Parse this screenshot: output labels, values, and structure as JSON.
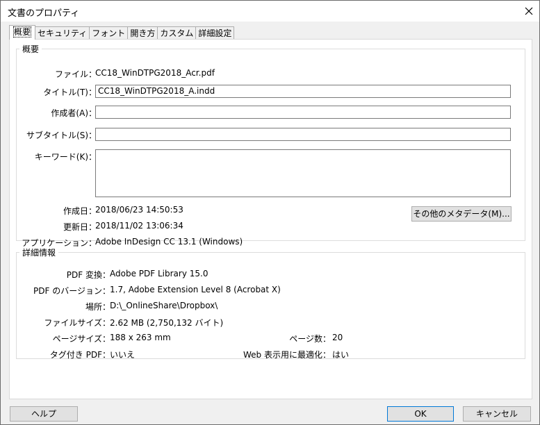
{
  "window": {
    "title": "文書のプロパティ"
  },
  "tabs": [
    {
      "label": "概要"
    },
    {
      "label": "セキュリティ"
    },
    {
      "label": "フォント"
    },
    {
      "label": "開き方"
    },
    {
      "label": "カスタム"
    },
    {
      "label": "詳細設定"
    }
  ],
  "summary": {
    "heading": "概要",
    "file_label": "ファイル：",
    "file_value": "CC18_WinDTPG2018_Acr.pdf",
    "title_label": "タイトル(T)：",
    "title_value": "CC18_WinDTPG2018_A.indd",
    "author_label": "作成者(A)：",
    "author_value": "",
    "subject_label": "サブタイトル(S)：",
    "subject_value": "",
    "keywords_label": "キーワード(K)：",
    "keywords_value": "",
    "created_label": "作成日：",
    "created_value": "2018/06/23 14:50:53",
    "modified_label": "更新日：",
    "modified_value": "2018/11/02 13:06:34",
    "application_label": "アプリケーション：",
    "application_value": "Adobe InDesign CC 13.1 (Windows)",
    "more_metadata_button": "その他のメタデータ(M)..."
  },
  "details": {
    "heading": "詳細情報",
    "producer_label": "PDF 変換：",
    "producer_value": "Adobe PDF Library 15.0",
    "version_label": "PDF のバージョン：",
    "version_value": "1.7, Adobe Extension Level 8 (Acrobat X)",
    "location_label": "場所：",
    "location_value": "D:\\_OnlineShare\\Dropbox\\",
    "filesize_label": "ファイルサイズ：",
    "filesize_value": "2.62 MB (2,750,132 バイト)",
    "pagesize_label": "ページサイズ：",
    "pagesize_value": "188 x 263 mm",
    "pagecount_label": "ページ数：",
    "pagecount_value": "20",
    "tagged_label": "タグ付き PDF：",
    "tagged_value": "いいえ",
    "fastweb_label": "Web 表示用に最適化：",
    "fastweb_value": "はい"
  },
  "footer": {
    "help_button": "ヘルプ",
    "ok_button": "OK",
    "cancel_button": "キャンセル"
  },
  "colors": {
    "accent": "#0078d7",
    "dialog_bg": "#f0f0f0",
    "panel_bg": "#ffffff"
  },
  "icons": {
    "close": "close-icon"
  }
}
